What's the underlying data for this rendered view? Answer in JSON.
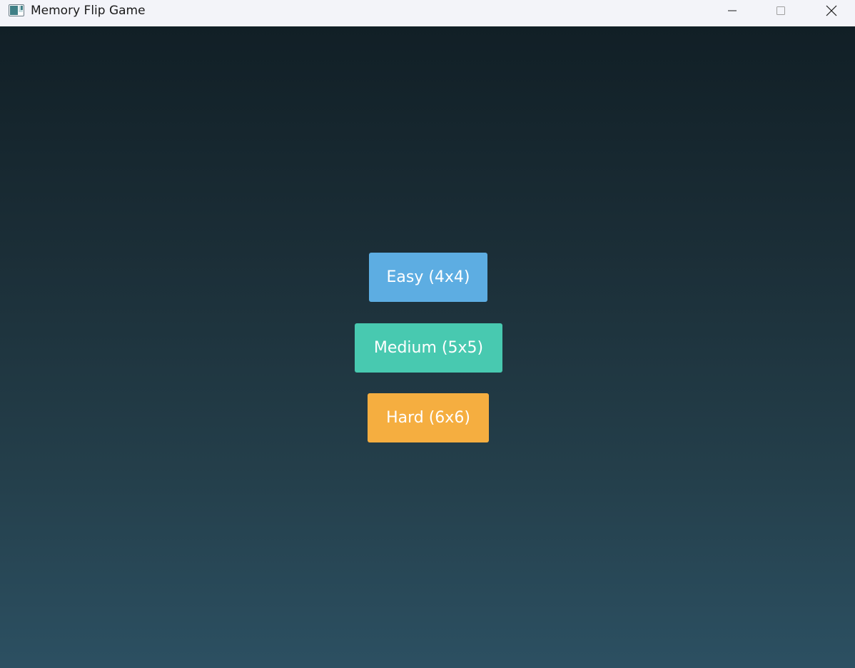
{
  "window": {
    "title": "Memory Flip Game",
    "icon": "app-window-icon"
  },
  "controls": {
    "minimize_icon": "minimize-icon",
    "maximize_icon": "maximize-icon",
    "close_icon": "close-icon"
  },
  "menu": {
    "buttons": [
      {
        "label": "Easy (4x4)",
        "color": "#5dade2"
      },
      {
        "label": "Medium (5x5)",
        "color": "#48c9b0"
      },
      {
        "label": "Hard (6x6)",
        "color": "#f5ae40"
      }
    ]
  },
  "colors": {
    "background_top": "#111f26",
    "background_bottom": "#2c5062",
    "titlebar": "#f3f4f9"
  }
}
